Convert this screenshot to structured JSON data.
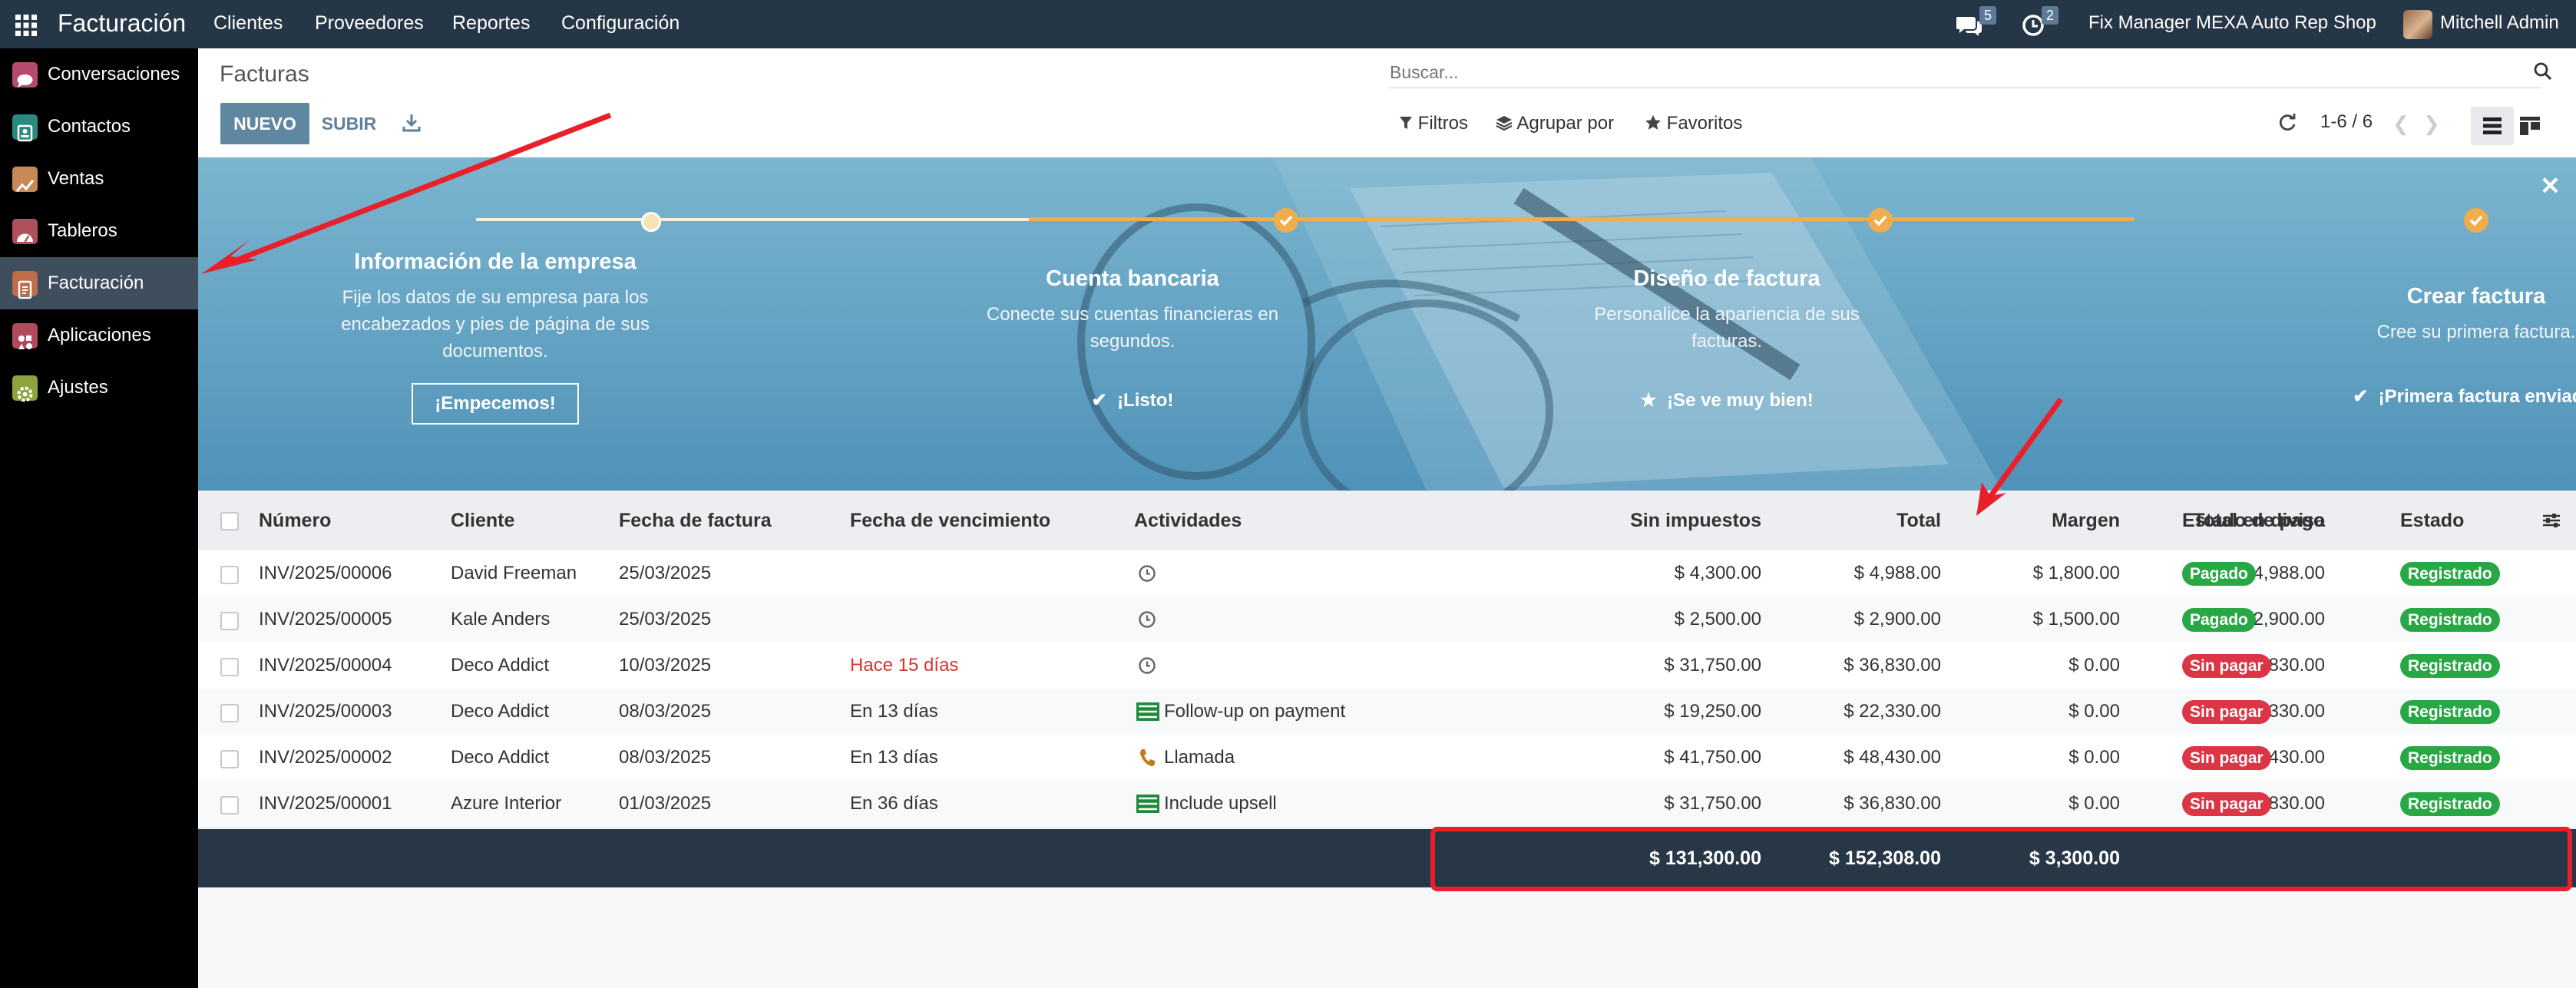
{
  "topbar": {
    "app_name": "Facturación",
    "menu": [
      "Clientes",
      "Proveedores",
      "Reportes",
      "Configuración"
    ],
    "messages_count": "5",
    "activities_count": "2",
    "company": "Fix Manager MEXA Auto Rep Shop",
    "user": "Mitchell Admin"
  },
  "sidebar": {
    "items": [
      {
        "label": "Conversaciones",
        "icon": "chat-icon",
        "color": "#b64a6d"
      },
      {
        "label": "Contactos",
        "icon": "contacts-icon",
        "color": "#2b8a80"
      },
      {
        "label": "Ventas",
        "icon": "sales-chart-icon",
        "color": "#c58a55"
      },
      {
        "label": "Tableros",
        "icon": "dashboard-icon",
        "color": "#b0505c"
      },
      {
        "label": "Facturación",
        "icon": "invoice-icon",
        "color": "#c06b4a"
      },
      {
        "label": "Aplicaciones",
        "icon": "apps-icon",
        "color": "#b24a5e"
      },
      {
        "label": "Ajustes",
        "icon": "gear-icon",
        "color": "#8ea33b"
      }
    ]
  },
  "control": {
    "breadcrumb": "Facturas",
    "new_label": "NUEVO",
    "upload_label": "SUBIR",
    "search_placeholder": "Buscar...",
    "filters_label": "Filtros",
    "groupby_label": "Agrupar por",
    "favorites_label": "Favoritos",
    "pager": "1-6 / 6"
  },
  "banner": {
    "steps": [
      {
        "title": "Información de la empresa",
        "desc": "Fije los datos de su empresa para los encabezados y pies de página de sus documentos.",
        "action": "¡Empecemos!"
      },
      {
        "title": "Cuenta bancaria",
        "desc": "Conecte sus cuentas financieras en segundos.",
        "done": "¡Listo!"
      },
      {
        "title": "Diseño de factura",
        "desc": "Personalice la apariencia de sus facturas.",
        "done": "¡Se ve muy bien!"
      },
      {
        "title": "Crear factura",
        "desc": "Cree su primera factura.",
        "done": "¡Primera factura enviada!"
      }
    ]
  },
  "table": {
    "headers": {
      "number": "Número",
      "customer": "Cliente",
      "invoice_date": "Fecha de factura",
      "due_date": "Fecha de vencimiento",
      "activities": "Actividades",
      "untaxed": "Sin impuestos",
      "total": "Total",
      "margin": "Margen",
      "total_currency": "Total en divisa",
      "payment_state": "Estado de pago",
      "state": "Estado"
    },
    "rows": [
      {
        "number": "INV/2025/00006",
        "customer": "David Freeman",
        "invoice_date": "25/03/2025",
        "due_date": "",
        "activity": "",
        "untaxed": "$ 4,300.00",
        "total": "$ 4,988.00",
        "margin": "$ 1,800.00",
        "total_currency": "$ 4,988.00",
        "payment_state": "Pagado",
        "state": "Registrado"
      },
      {
        "number": "INV/2025/00005",
        "customer": "Kale Anders",
        "invoice_date": "25/03/2025",
        "due_date": "",
        "activity": "",
        "untaxed": "$ 2,500.00",
        "total": "$ 2,900.00",
        "margin": "$ 1,500.00",
        "total_currency": "$ 2,900.00",
        "payment_state": "Pagado",
        "state": "Registrado"
      },
      {
        "number": "INV/2025/00004",
        "customer": "Deco Addict",
        "invoice_date": "10/03/2025",
        "due_date": "Hace 15 días",
        "activity": "",
        "untaxed": "$ 31,750.00",
        "total": "$ 36,830.00",
        "margin": "$ 0.00",
        "total_currency": "$ 36,830.00",
        "payment_state": "Sin pagar",
        "state": "Registrado"
      },
      {
        "number": "INV/2025/00003",
        "customer": "Deco Addict",
        "invoice_date": "08/03/2025",
        "due_date": "En 13 días",
        "activity": "Follow-up on payment",
        "untaxed": "$ 19,250.00",
        "total": "$ 22,330.00",
        "margin": "$ 0.00",
        "total_currency": "$ 22,330.00",
        "payment_state": "Sin pagar",
        "state": "Registrado"
      },
      {
        "number": "INV/2025/00002",
        "customer": "Deco Addict",
        "invoice_date": "08/03/2025",
        "due_date": "En 13 días",
        "activity": "Llamada",
        "untaxed": "$ 41,750.00",
        "total": "$ 48,430.00",
        "margin": "$ 0.00",
        "total_currency": "$ 48,430.00",
        "payment_state": "Sin pagar",
        "state": "Registrado"
      },
      {
        "number": "INV/2025/00001",
        "customer": "Azure Interior",
        "invoice_date": "01/03/2025",
        "due_date": "En 36 días",
        "activity": "Include upsell",
        "untaxed": "$ 31,750.00",
        "total": "$ 36,830.00",
        "margin": "$ 0.00",
        "total_currency": "$ 36,830.00",
        "payment_state": "Sin pagar",
        "state": "Registrado"
      }
    ],
    "totals": {
      "untaxed": "$ 131,300.00",
      "total": "$ 152,308.00",
      "margin": "$ 3,300.00"
    }
  },
  "colors": {
    "paid": "#28a745",
    "unpaid": "#dc3545",
    "posted": "#28a745",
    "overdue": "#d9332d",
    "annotation": "#e8202a",
    "primary": "#5f879f"
  }
}
